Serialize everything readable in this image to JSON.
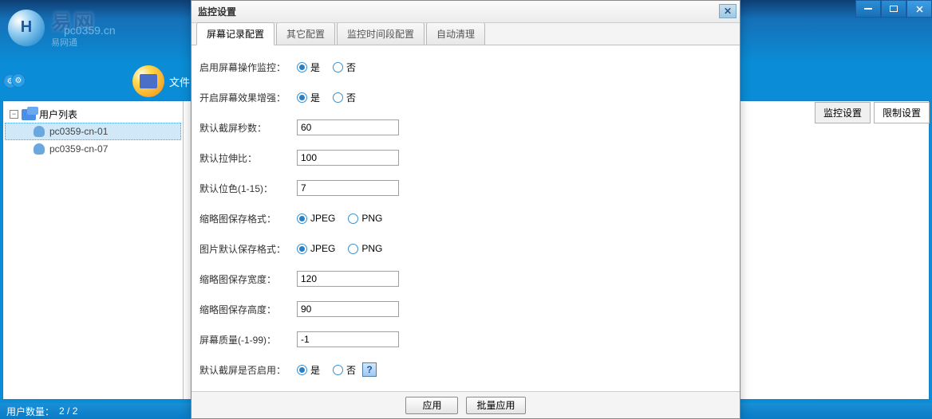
{
  "mainWindow": {
    "logoChar": "H",
    "logoText": "易网",
    "logoSub": "易网通",
    "watermark": "pc0359.cn",
    "fileLabel": "文件"
  },
  "tree": {
    "rootLabel": "用户列表",
    "children": [
      {
        "label": "pc0359-cn-01",
        "selected": true
      },
      {
        "label": "pc0359-cn-07",
        "selected": false
      }
    ]
  },
  "rightTabs": {
    "monitorSettings": "监控设置",
    "limitSettings": "限制设置"
  },
  "status": {
    "label": "用户数量：",
    "count": "2 / 2"
  },
  "dialog": {
    "title": "监控设置",
    "tabs": {
      "screenRecord": "屏幕记录配置",
      "other": "其它配置",
      "schedule": "监控时间段配置",
      "autoClean": "自动清理"
    },
    "form": {
      "enableMonitor": {
        "label": "启用屏幕操作监控：",
        "yes": "是",
        "no": "否"
      },
      "enhance": {
        "label": "开启屏幕效果增强：",
        "yes": "是",
        "no": "否"
      },
      "defaultSeconds": {
        "label": "默认截屏秒数：",
        "value": "60"
      },
      "stretchRatio": {
        "label": "默认拉伸比：",
        "value": "100"
      },
      "bitDepth": {
        "label": "默认位色(1-15)：",
        "value": "7"
      },
      "thumbFormat": {
        "label": "缩略图保存格式：",
        "jpeg": "JPEG",
        "png": "PNG"
      },
      "imageFormat": {
        "label": "图片默认保存格式：",
        "jpeg": "JPEG",
        "png": "PNG"
      },
      "thumbWidth": {
        "label": "缩略图保存宽度：",
        "value": "120"
      },
      "thumbHeight": {
        "label": "缩略图保存高度：",
        "value": "90"
      },
      "quality": {
        "label": "屏幕质量(-1-99)：",
        "value": "-1"
      },
      "defaultEnabled": {
        "label": "默认截屏是否启用：",
        "yes": "是",
        "no": "否"
      }
    },
    "footer": {
      "apply": "应用",
      "batchApply": "批量应用"
    }
  }
}
